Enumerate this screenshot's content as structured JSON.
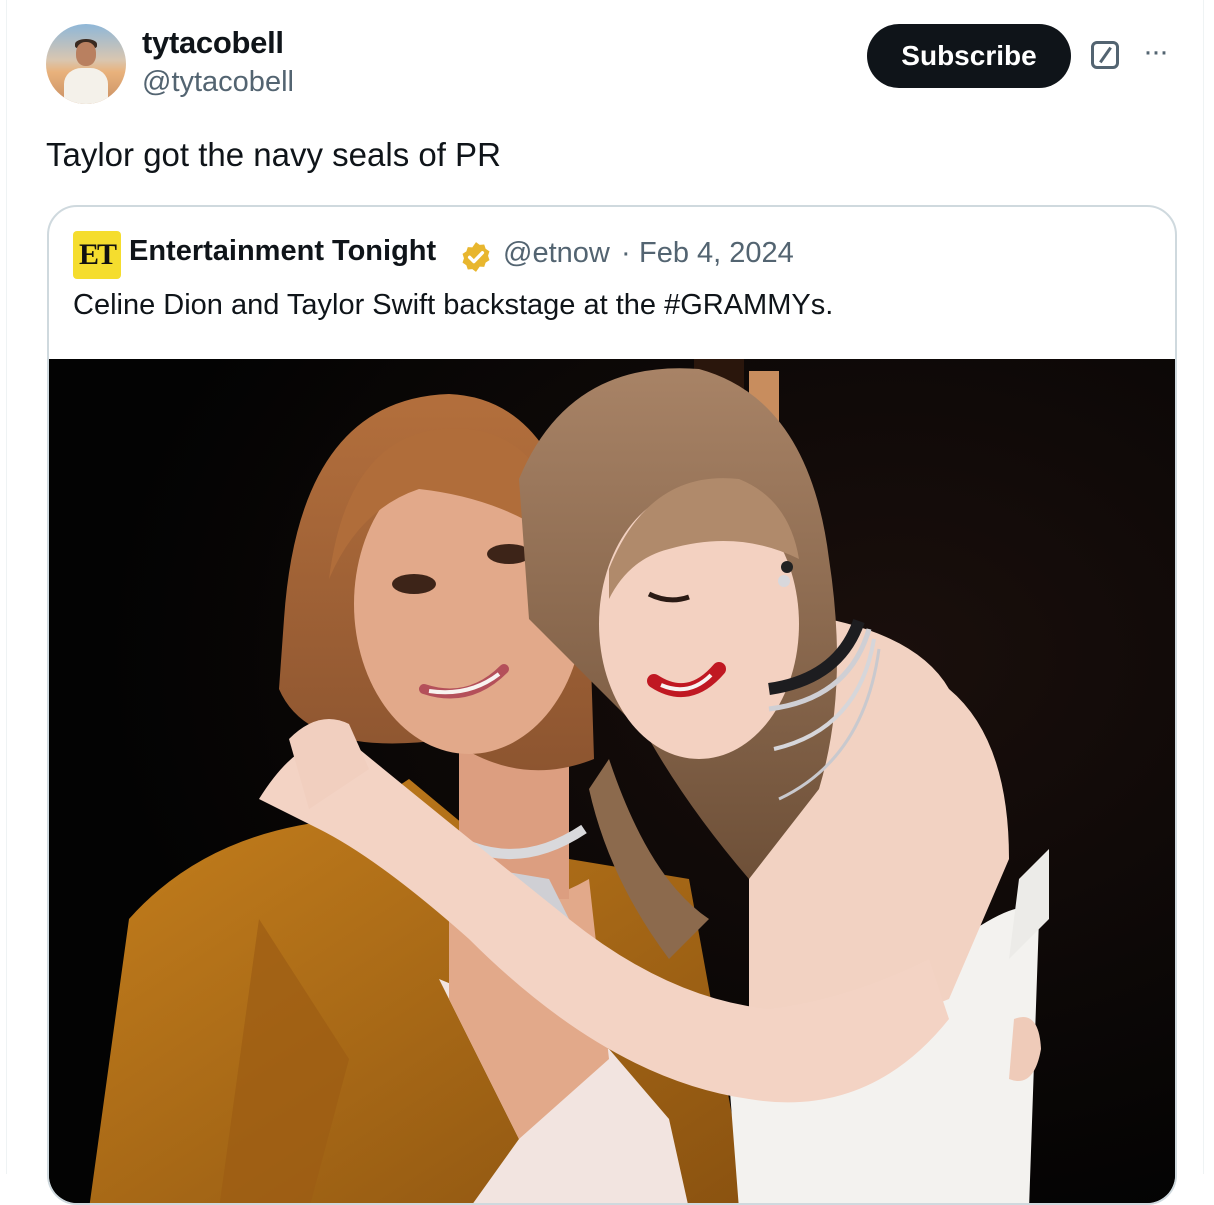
{
  "author": {
    "display_name": "tytacobell",
    "handle": "@tytacobell"
  },
  "actions": {
    "subscribe_label": "Subscribe",
    "grok_icon": "grok-icon",
    "more_icon": "more-icon"
  },
  "tweet": {
    "text": "Taylor got the navy seals of PR"
  },
  "quoted": {
    "logo_text": "ET",
    "display_name": "Entertainment Tonight",
    "verified_icon": "gold-verified-badge",
    "handle": "@etnow",
    "separator": "·",
    "date": "Feb 4, 2024",
    "text": "Celine Dion and Taylor Swift backstage at the #GRAMMYs."
  },
  "colors": {
    "text_primary": "#0f1419",
    "text_secondary": "#536471",
    "border": "#cfd9de",
    "button_bg": "#0f1419",
    "logo_bg": "#f5dd2e",
    "verified": "#e8b62e"
  }
}
